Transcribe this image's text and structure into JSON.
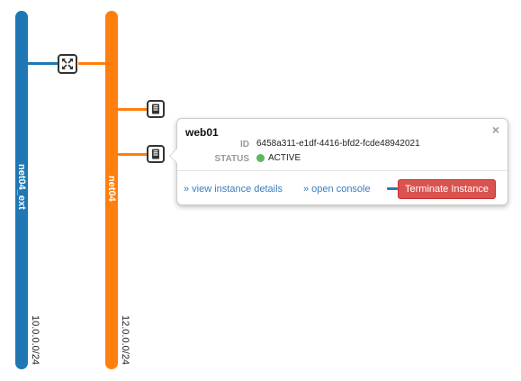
{
  "networks": [
    {
      "name": "net04_ext",
      "cidr": "10.0.0.0/24",
      "color": "#1f77b4"
    },
    {
      "name": "net04",
      "cidr": "12.0.0.0/24",
      "color": "#ff7f0e"
    }
  ],
  "devices": {
    "router_icon": "router-icon",
    "instance_icon": "server-icon"
  },
  "popup": {
    "title": "web01",
    "id_label": "ID",
    "id_value": "6458a311-e1df-4416-bfd2-fcde48942021",
    "status_label": "STATUS",
    "status_value": "ACTIVE",
    "status_color": "#5cb85c",
    "close_glyph": "×",
    "view_details_label": "» view instance details",
    "open_console_label": "» open console",
    "terminate_label": "Terminate Instance",
    "terminate_color": "#d9534f"
  }
}
